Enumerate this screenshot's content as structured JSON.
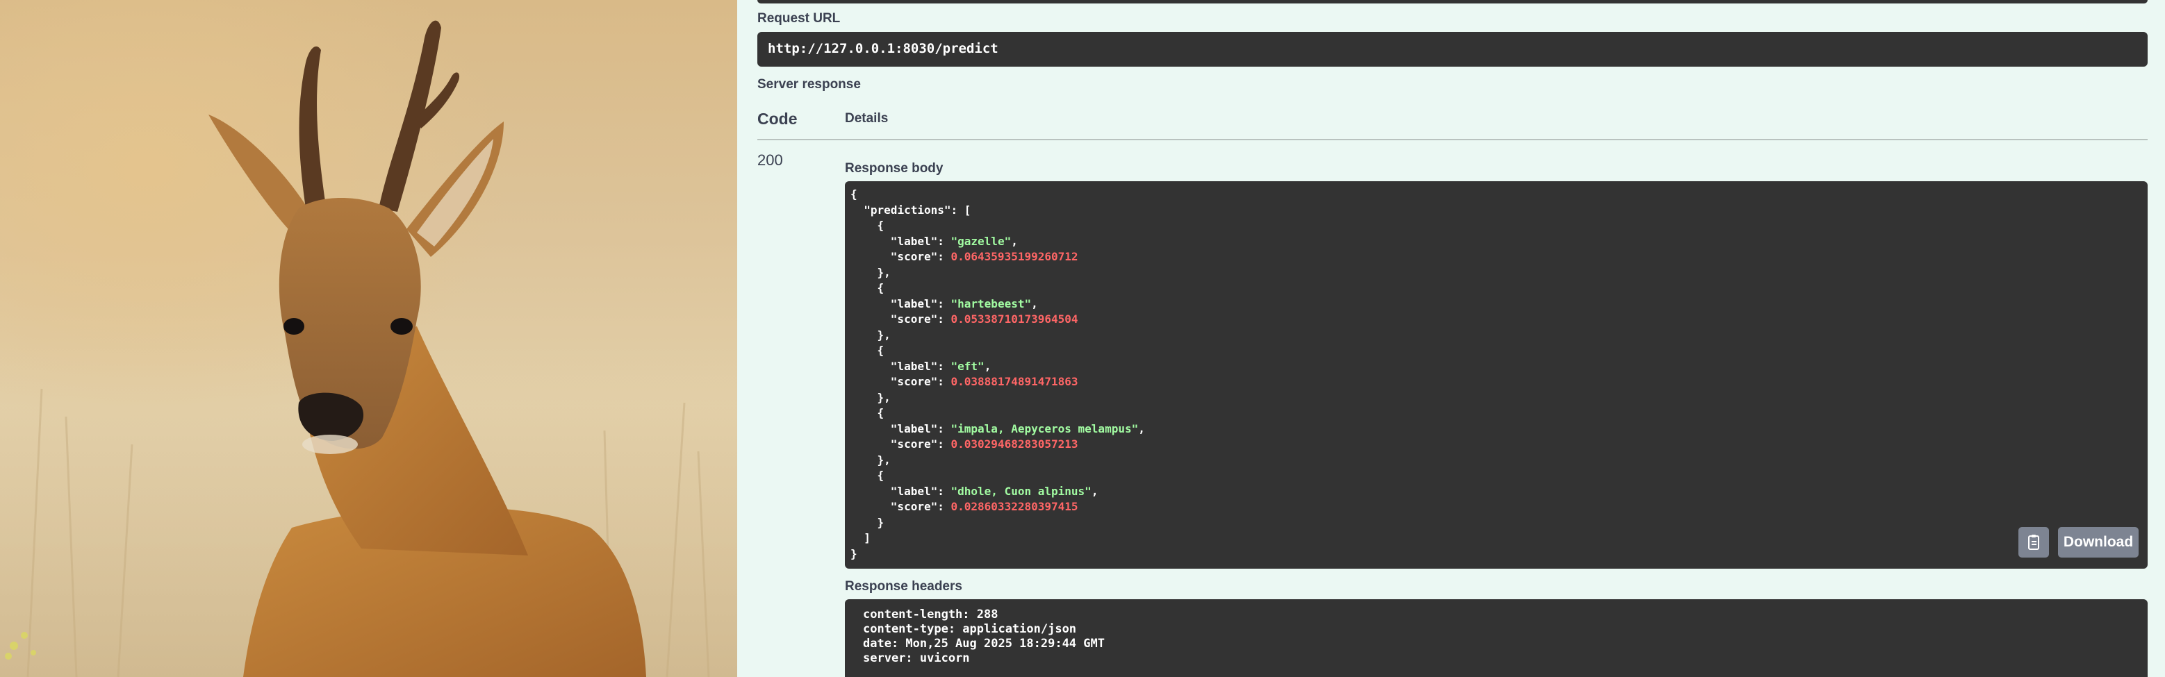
{
  "request_url": {
    "label": "Request URL",
    "value": "http://127.0.0.1:8030/predict"
  },
  "server_response": {
    "label": "Server response",
    "code_header": "Code",
    "details_header": "Details",
    "status_code": "200"
  },
  "response_body": {
    "label": "Response body",
    "predictions_key": "predictions",
    "predictions": [
      {
        "label": "gazelle",
        "score": "0.06435935199260712"
      },
      {
        "label": "hartebeest",
        "score": "0.05338710173964504"
      },
      {
        "label": "eft",
        "score": "0.03888174891471863"
      },
      {
        "label": "impala, Aepyceros melampus",
        "score": "0.03029468283057213"
      },
      {
        "label": "dhole, Cuon alpinus",
        "score": "0.02860332280397415"
      }
    ],
    "copy_icon": "clipboard-copy-icon",
    "download_label": "Download"
  },
  "response_headers": {
    "label": "Response headers",
    "lines": [
      "content-length: 288",
      "content-type: application/json",
      "date: Mon,25 Aug 2025 18:29:44 GMT",
      "server: uvicorn"
    ]
  },
  "colors": {
    "page_background": "#ebf8f3",
    "code_background": "#333333",
    "string_token": "#a2fca2",
    "number_token": "#ff6666",
    "button_gray": "#7d8492",
    "label_text": "#3b4151"
  }
}
